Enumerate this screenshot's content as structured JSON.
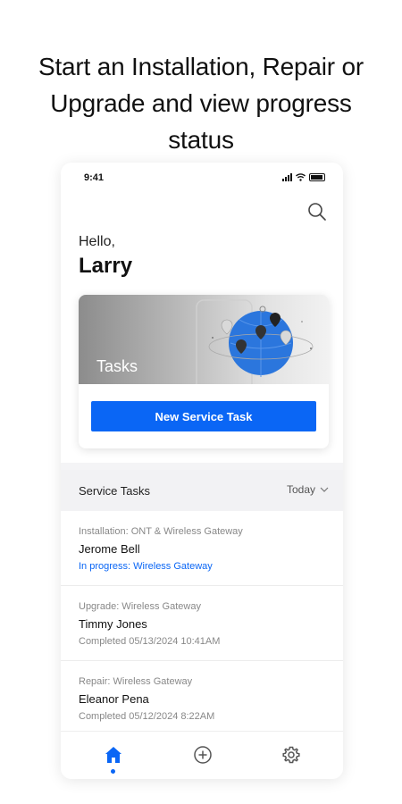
{
  "headline": {
    "line1": "Start an Installation, Repair or",
    "line2": "Upgrade and view progress",
    "line3": "status"
  },
  "status_bar": {
    "time": "9:41"
  },
  "greeting": {
    "hello": "Hello,",
    "name": "Larry"
  },
  "tasks_card": {
    "title": "Tasks",
    "button_label": "New Service Task"
  },
  "service_tasks": {
    "title": "Service Tasks",
    "filter_label": "Today",
    "items": [
      {
        "type": "Installation: ONT & Wireless Gateway",
        "person": "Jerome Bell",
        "status": "In progress: Wireless Gateway"
      },
      {
        "type": "Upgrade: Wireless Gateway",
        "person": "Timmy Jones",
        "status": "Completed 05/13/2024 10:41AM"
      },
      {
        "type": "Repair: Wireless Gateway",
        "person": "Eleanor Pena",
        "status": "Completed 05/12/2024 8:22AM"
      }
    ]
  },
  "tab_bar": {
    "tabs": [
      {
        "icon": "home-icon",
        "active": true
      },
      {
        "icon": "plus-circle-icon",
        "active": false
      },
      {
        "icon": "gear-icon",
        "active": false
      }
    ]
  },
  "colors": {
    "accent": "#0a66f5",
    "status_progress": "#0a66f5",
    "muted_text": "#888888"
  }
}
